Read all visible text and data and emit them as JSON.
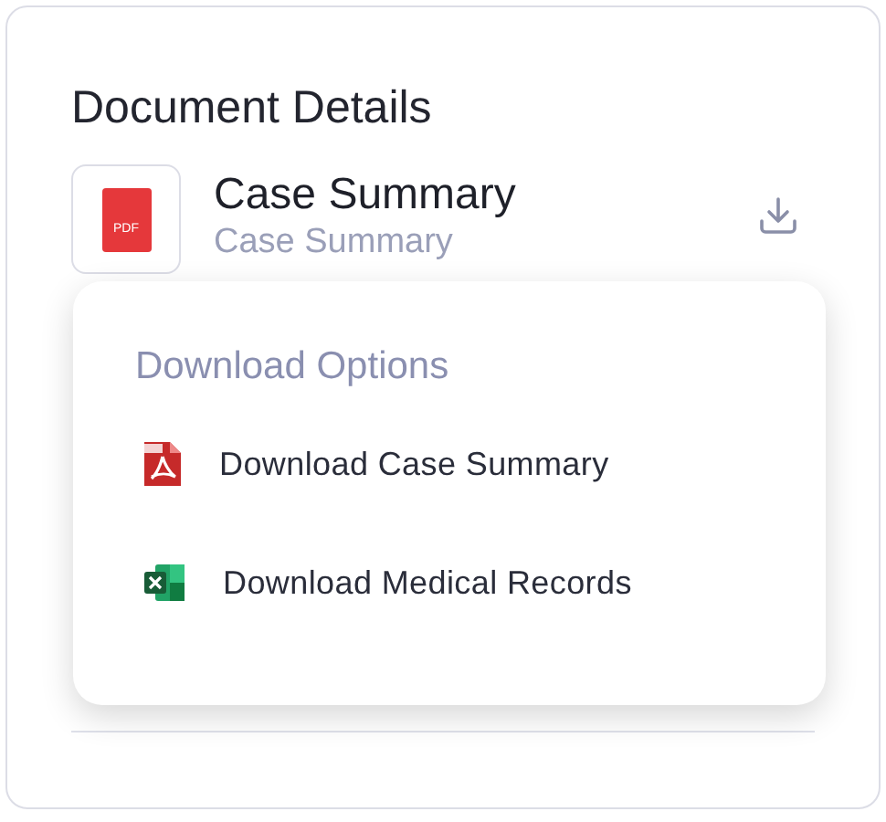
{
  "panel": {
    "title": "Document Details"
  },
  "document": {
    "name": "Case Summary",
    "subtitle": "Case Summary",
    "file_type": "PDF"
  },
  "download_menu": {
    "title": "Download Options",
    "items": [
      {
        "kind": "pdf",
        "label": "Download Case Summary"
      },
      {
        "kind": "excel",
        "label": "Download Medical Records"
      }
    ]
  }
}
